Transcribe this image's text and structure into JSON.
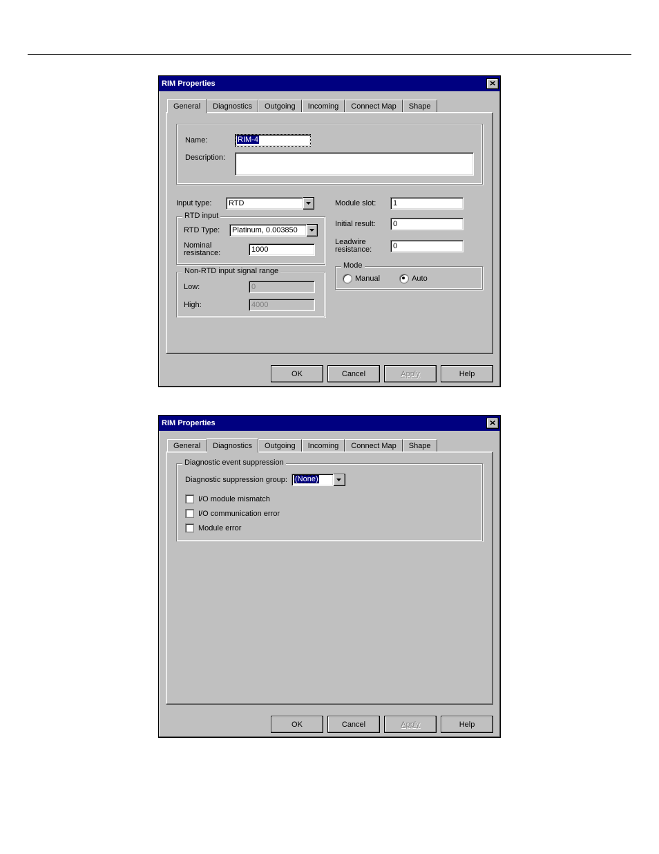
{
  "dialog1": {
    "title": "RIM Properties",
    "close_glyph": "✕",
    "tabs": [
      "General",
      "Diagnostics",
      "Outgoing",
      "Incoming",
      "Connect Map",
      "Shape"
    ],
    "active_tab": 0,
    "name_label": "Name:",
    "name_value": "RIM-4",
    "description_label": "Description:",
    "description_value": "",
    "input_type_label": "Input type:",
    "input_type_value": "RTD",
    "rtd_input": {
      "legend": "RTD input",
      "rtd_type_label": "RTD Type:",
      "rtd_type_value": "Platinum, 0.003850",
      "nominal_label": "Nominal resistance:",
      "nominal_value": "1000"
    },
    "nonrtd": {
      "legend": "Non-RTD input signal range",
      "low_label": "Low:",
      "low_value": "0",
      "high_label": "High:",
      "high_value": "4000"
    },
    "module_slot_label": "Module slot:",
    "module_slot_value": "1",
    "initial_result_label": "Initial result:",
    "initial_result_value": "0",
    "leadwire_label": "Leadwire resistance:",
    "leadwire_value": "0",
    "mode": {
      "legend": "Mode",
      "manual_label": "Manual",
      "auto_label": "Auto",
      "selected": "auto"
    },
    "buttons": {
      "ok": "OK",
      "cancel": "Cancel",
      "apply": "Apply",
      "help": "Help"
    }
  },
  "dialog2": {
    "title": "RIM Properties",
    "close_glyph": "✕",
    "tabs": [
      "General",
      "Diagnostics",
      "Outgoing",
      "Incoming",
      "Connect Map",
      "Shape"
    ],
    "active_tab": 1,
    "diag": {
      "legend": "Diagnostic event suppression",
      "group_label": "Diagnostic suppression group:",
      "group_value": "(None)",
      "chk1": "I/O module mismatch",
      "chk2": "I/O communication error",
      "chk3": "Module error"
    },
    "buttons": {
      "ok": "OK",
      "cancel": "Cancel",
      "apply": "Apply",
      "help": "Help"
    }
  }
}
